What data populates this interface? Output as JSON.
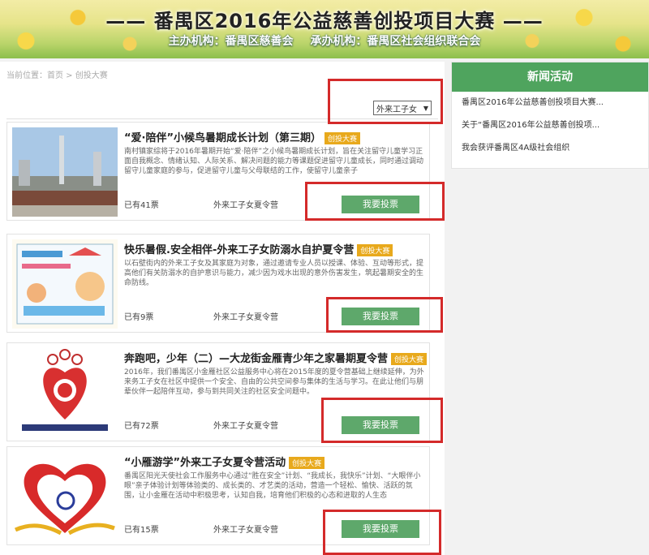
{
  "banner": {
    "title": "—— 番禺区2016年公益慈善创投项目大赛 ——",
    "organizer": "主办机构：番禺区慈善会",
    "undertaker": "承办机构：番禺区社会组织联合会"
  },
  "breadcrumb": "当前位置：首页 > 创投大赛",
  "filter": {
    "selected": "外来工子女"
  },
  "items": [
    {
      "title": "“爱·陪伴”小候鸟暑期成长计划（第三期）",
      "badge": "创投大赛",
      "desc": "南村镇家综将于2016年暑期开始“爱·陪伴”之小候鸟暑期成长计划，旨在关注留守儿童学习正面自我概念、情绪认知、人际关系、解决问题的能力等课题促进留守儿童成长，同时通过调动留守儿童家庭的参与，促进留守儿童与父母联结的工作，使留守儿童亲子",
      "votes": "已有41票",
      "tag": "外来工子女夏令营",
      "button": "我要投票"
    },
    {
      "title": "快乐暑假.安全相伴-外来工子女防溺水自护夏令营",
      "badge": "创投大赛",
      "desc": "以石壁街内的外来工子女及其家庭为对象，通过邀请专业人员以授课、体验、互动等形式，提高他们有关防溺水的自护意识与能力，减少因为戏水出现的意外伤害发生，筑起暑期安全的生命防线。",
      "votes": "已有9票",
      "tag": "外来工子女夏令营",
      "button": "我要投票"
    },
    {
      "title": "奔跑吧，少年（二）—大龙街金雁青少年之家暑期夏令营",
      "badge": "创投大赛",
      "desc": "2016年，我们番禺区小金雁社区公益服务中心将在2015年度的夏令营基础上继续延伸，为外来务工子女在社区中提供一个安全、自由的公共空间参与集体的生活与学习。在此让他们与朋辈伙伴一起陪伴互动，参与到共同关注的社区安全问题中。",
      "votes": "已有72票",
      "tag": "外来工子女夏令营",
      "button": "我要投票"
    },
    {
      "title": "“小雁游学”外来工子女夏令营活动",
      "badge": "创投大赛",
      "desc": "番禺区阳光天使社会工作服务中心通过“胜在安全”计划、“我成长，我快乐”计划、“大眼伴小眼”亲子体验计划等体验类的、成长类的、才艺类的活动，营造一个轻松、愉快、活跃的氛围，让小金雁在活动中积极思考，认知自我，培育他们积极的心态和进取的人生态",
      "votes": "已有15票",
      "tag": "外来工子女夏令营",
      "button": "我要投票"
    }
  ],
  "sidebar": {
    "heading": "新闻活动",
    "news": [
      "番禺区2016年公益慈善创投项目大赛...",
      "关于“番禺区2016年公益慈善创投项...",
      "我会获评番禺区4A级社会组织"
    ]
  },
  "colors": {
    "accent_green": "#4fa45e",
    "button_green": "#5ea86b",
    "badge_orange": "#e8a91c",
    "highlight_red": "#d42a2a"
  }
}
